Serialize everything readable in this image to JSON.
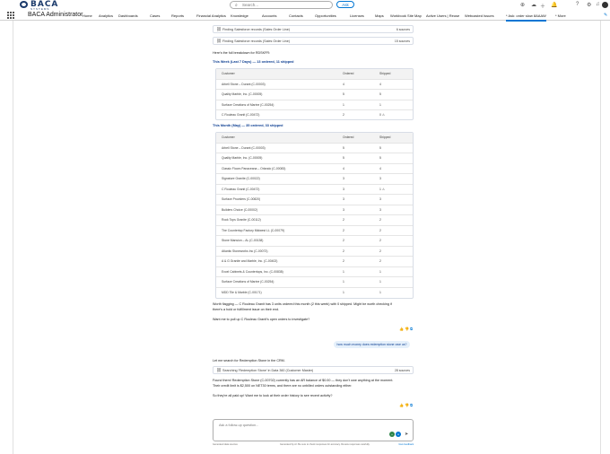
{
  "topbar": {
    "logo_text": "BACA",
    "logo_sub": "SYSTEMS",
    "search_placeholder": "Search...",
    "ask_label": "Ask"
  },
  "nav": {
    "app_name": "BACA Administrator",
    "items": [
      "Home",
      "Analytics",
      "Dashboards",
      "Cases",
      "Reports",
      "Financial Analytics",
      "Knowledge",
      "Accounts",
      "Contacts",
      "Opportunities",
      "Licenses",
      "Maps",
      "Workbook Site Map",
      "Active Users | Reuse",
      "Webcasted Issues",
      "* Ask: order slow 8AAAW",
      "* More"
    ]
  },
  "chat": {
    "sources": [
      {
        "label": "Finding Salesforce records (Sales Order Line)",
        "count": "6 sources"
      },
      {
        "label": "Finding Salesforce records (Sales Order Line)",
        "count": "15 sources"
      }
    ],
    "intro": "Here's the full breakdown for RDSKFR:",
    "week_heading": "This Week (Last 7 Days) — 13 ordered, 11 shipped",
    "week_headers": [
      "Customer",
      "Ordered",
      "Shipped"
    ],
    "week_rows": [
      [
        "Arbell Stone – Durant (C-00003)",
        "4",
        "4"
      ],
      [
        "Quality Marble, Inc. (C-00005)",
        "5",
        "5"
      ],
      [
        "Surface Creations of Marine (C-00254)",
        "1",
        "1"
      ],
      [
        "C Rouleau Granit (C-00472)",
        "2",
        "0 ⚠"
      ]
    ],
    "month_heading": "This Month (May) — 35 ordered, 33 shipped",
    "month_headers": [
      "Customer",
      "Ordered",
      "Shipped"
    ],
    "month_rows": [
      [
        "Arbell Stone – Durant (C-00003)",
        "5",
        "5"
      ],
      [
        "Quality Marble, Inc. (C-00005)",
        "5",
        "5"
      ],
      [
        "Classic Floors Panaceana – Orlando (C-00083)",
        "4",
        "4"
      ],
      [
        "Signature Granite (C-00022)",
        "3",
        "3"
      ],
      [
        "C Rouleau Granit (C-00472)",
        "3",
        "1 ⚠"
      ],
      [
        "Surface Providers (C-00820)",
        "3",
        "3"
      ],
      [
        "Builders Choice (C-00002)",
        "3",
        "3"
      ],
      [
        "Rock Tops Granite (C-00112)",
        "2",
        "2"
      ],
      [
        "The Countertop Factory Midwest LL (C-00079)",
        "2",
        "2"
      ],
      [
        "Stone Mansion – AL (C-00138)",
        "2",
        "2"
      ],
      [
        "Atlantic Stoneworks Inc (C-00073)",
        "2",
        "2"
      ],
      [
        "A & G Granite and Marble, Inc. (C-00402)",
        "2",
        "2"
      ],
      [
        "Excel Cabinets & Countertops, Inc. (C-00838)",
        "1",
        "1"
      ],
      [
        "Surface Creations of Marine (C-00254)",
        "1",
        "1"
      ],
      [
        "MDD Tile & Marble (C-00171)",
        "1",
        "1"
      ]
    ],
    "flag_line1": "Worth flagging — C Rouleau Granit has 3 units ordered this month (2 this week) with 0 shipped. Might be worth checking if",
    "flag_line2": "there's a hold or fulfillment issue on their end.",
    "question": "Want me to pull up C Rouleau Granit's open orders to investigate?",
    "user_msg": "how much money does redemption stone owe us?",
    "lookup": "Let me search for Redemption Stone in the CRM.",
    "search_source": {
      "label": "Searching 'Redemption Stone' in Data 360 (Customer Master)",
      "count": "28 sources"
    },
    "found_line1": "Found them! Redemption Stone (C-00702) currently has an AR balance of $0.00 — they don't owe anything at the moment.",
    "found_line2": "Their credit limit is $2,500 on NET30 terms, and there are no unbilled orders outstanding either.",
    "followup": "So they're all paid up! Want me to look at their order history to see recent activity?",
    "input_placeholder": "Ask a follow-up question...",
    "footer_left": "Generated data sources",
    "footer_mid": "Generated by AI. Be sure to check responses for accuracy. Review responses carefully.",
    "footer_right": "Give feedback"
  },
  "colors": {
    "accent": "#0176d3",
    "heading": "#0b3d91",
    "warning": "#e8a317"
  }
}
